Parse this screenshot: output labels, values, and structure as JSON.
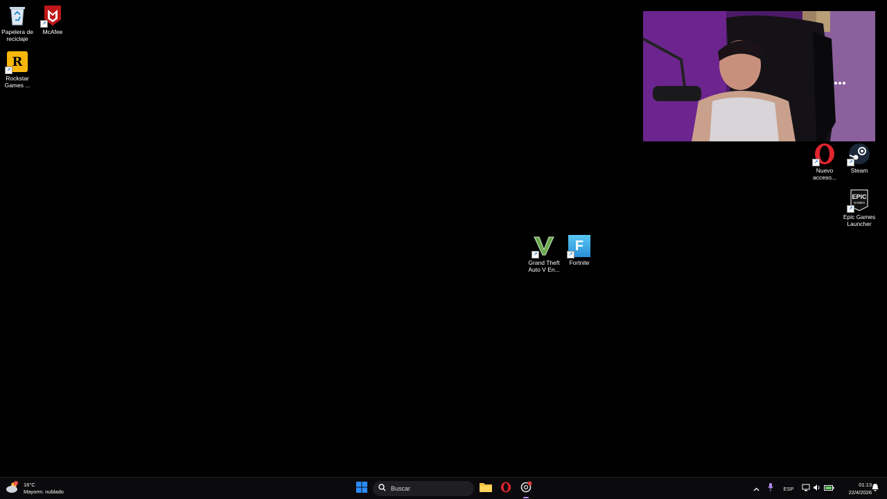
{
  "desktop": {
    "icons": [
      {
        "label": "Papelera de reciclaje",
        "icon": "recycle-bin-icon"
      },
      {
        "label": "McAfee",
        "icon": "mcafee-icon"
      },
      {
        "label": "Rockstar Games ...",
        "icon": "rockstar-icon"
      },
      {
        "label": "Nuevo acceso...",
        "icon": "opera-icon"
      },
      {
        "label": "Steam",
        "icon": "steam-icon"
      },
      {
        "label": "Epic Games Launcher",
        "icon": "epic-games-icon"
      },
      {
        "label": "Grand Theft Auto V En...",
        "icon": "gta-v-icon"
      },
      {
        "label": "Fortnite",
        "icon": "fortnite-icon"
      }
    ]
  },
  "taskbar": {
    "weather": {
      "temp": "16°C",
      "condition": "Mayorm. nublado",
      "icon": "weather-cloud-icon"
    },
    "search": {
      "placeholder": "Buscar"
    },
    "tray": {
      "language": "ESP"
    },
    "clock": {
      "time": "01:13",
      "date": "22/4/2026"
    }
  },
  "colors": {
    "desktop_bg": "#000000",
    "taskbar_bg": "#0b0b0d",
    "windows_blue": "#2b8cff",
    "opera_red": "#e0242e",
    "mcafee_red": "#c01818",
    "rockstar_yellow": "#f7b60b",
    "fortnite_blue": "#3fb2ea",
    "gta_green": "#6aa84f"
  }
}
